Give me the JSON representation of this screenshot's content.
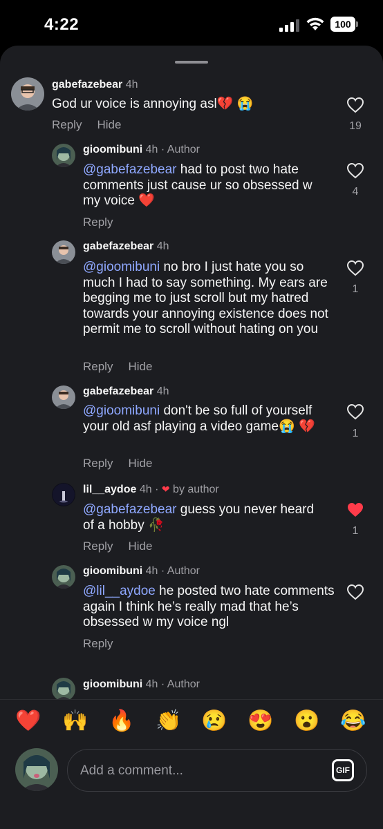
{
  "status": {
    "time": "4:22",
    "battery": "100"
  },
  "comments": [
    {
      "username": "gabefazebear",
      "time": "4h",
      "tag": "",
      "mention": "",
      "text": "God ur voice is annoying asl💔 😭",
      "actions": [
        "Reply",
        "Hide"
      ],
      "likes": "19",
      "liked": false
    },
    {
      "username": "gioomibuni",
      "time": "4h",
      "tag": "· Author",
      "mention": "@gabefazebear",
      "text": " had to post two hate comments just cause ur so obsessed w my voice ❤️",
      "actions": [
        "Reply"
      ],
      "likes": "4",
      "liked": false
    },
    {
      "username": "gabefazebear",
      "time": "4h",
      "tag": "",
      "mention": "@gioomibuni",
      "text": " no bro I just hate you so much I had to say something. My ears are begging me to just scroll but my hatred towards your annoying existence does not permit me to scroll without hating on you",
      "actions": [
        "Reply",
        "Hide"
      ],
      "likes": "1",
      "liked": false
    },
    {
      "username": "gabefazebear",
      "time": "4h",
      "tag": "",
      "mention": "@gioomibuni",
      "text": " don't be so full of yourself your old asf playing a video game😭 💔",
      "actions": [
        "Reply",
        "Hide"
      ],
      "likes": "1",
      "liked": false
    },
    {
      "username": "lil__aydoe",
      "time": "4h",
      "tag": "·",
      "tag_heart": "❤",
      "tag_after": "by author",
      "mention": "@gabefazebear",
      "text": " guess you never heard of a hobby 🥀",
      "actions": [
        "Reply",
        "Hide"
      ],
      "likes": "1",
      "liked": true
    },
    {
      "username": "gioomibuni",
      "time": "4h",
      "tag": "· Author",
      "mention": "@lil__aydoe",
      "text": " he posted two hate comments again I think he’s really mad that he’s obsessed w my voice ngl",
      "actions": [
        "Reply"
      ],
      "likes": "",
      "liked": false
    },
    {
      "username": "gioomibuni",
      "time": "4h",
      "tag": "· Author",
      "mention": "",
      "text": "",
      "actions": [],
      "likes": "",
      "liked": false
    }
  ],
  "emojis": [
    "❤️",
    "🙌",
    "🔥",
    "👏",
    "😢",
    "😍",
    "😮",
    "😂"
  ],
  "composer": {
    "placeholder": "Add a comment...",
    "gif_label": "GIF"
  },
  "colors": {
    "mention": "#8fa8ff",
    "like_active": "#ff3b4a",
    "sheet_bg": "#1c1d21"
  }
}
